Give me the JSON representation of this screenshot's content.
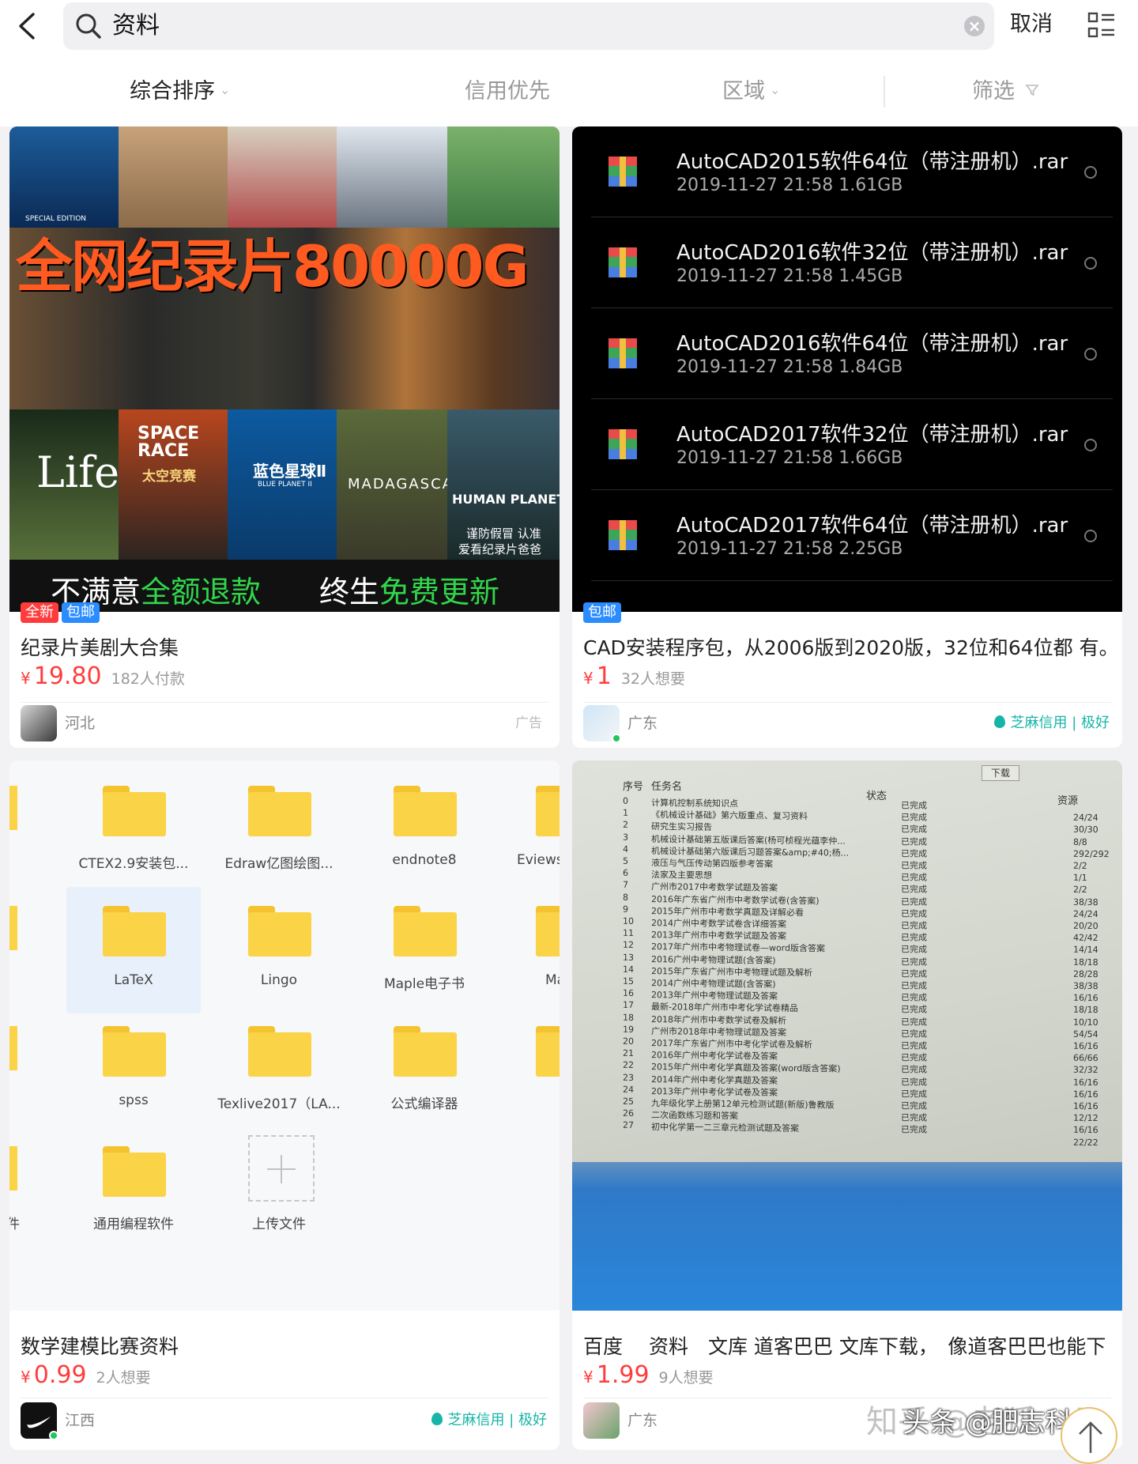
{
  "header": {
    "back_label": "",
    "search_query": "资料",
    "cancel_label": "取消"
  },
  "filters": {
    "sort": "综合排序",
    "credit": "信用优先",
    "region": "区域",
    "filter": "筛选"
  },
  "colors": {
    "price": "#ff3d3d",
    "credit": "#17b5a8",
    "tag_new": "#ff3b3b",
    "tag_ship": "#2b8cff",
    "folder": "#fbd346"
  },
  "cards": [
    {
      "image": {
        "headline": "全网纪录片80000G",
        "left_plain": "不满意",
        "left_highlight": "全额退款",
        "right_plain": "终生",
        "right_highlight": "免费更新",
        "posters": [
          "Life",
          "SPACE RACE",
          "太空竞赛",
          "蓝色星球Ⅱ",
          "BLUE PLANET II",
          "MADAGASCAR",
          "HUMAN PLANET",
          "谨防假冒 认准",
          "爱看纪录片爸爸"
        ],
        "special_edition": "SPECIAL EDITION"
      },
      "tags": [
        "全新",
        "包邮"
      ],
      "title": "纪录片美剧大合集",
      "currency": "¥",
      "price": "19.80",
      "want": "182人付款",
      "region": "河北",
      "ad": "广告"
    },
    {
      "files": [
        {
          "name": "AutoCAD2015软件64位（带注册机）.rar",
          "date": "2019-11-27  21:58",
          "size": "1.61GB"
        },
        {
          "name": "AutoCAD2016软件32位（带注册机）.rar",
          "date": "2019-11-27  21:58",
          "size": "1.45GB"
        },
        {
          "name": "AutoCAD2016软件64位（带注册机）.rar",
          "date": "2019-11-27  21:58",
          "size": "1.84GB"
        },
        {
          "name": "AutoCAD2017软件32位（带注册机）.rar",
          "date": "2019-11-27  21:58",
          "size": "1.66GB"
        },
        {
          "name": "AutoCAD2017软件64位（带注册机）.rar",
          "date": "2019-11-27  21:58",
          "size": "2.25GB"
        }
      ],
      "tags": [
        "包邮"
      ],
      "title": "CAD安装程序包，从2006版到2020版，32位和64位都 有。",
      "currency": "¥",
      "price": "1",
      "want": "32人想要",
      "region": "广东",
      "credit": "芝麻信用 | 极好"
    },
    {
      "folders": [
        {
          "label": "CTEX2.9安装包..."
        },
        {
          "label": "Edraw亿图绘图..."
        },
        {
          "label": "endnote8"
        },
        {
          "label": "Eviews"
        },
        {
          "label": "LaTeX"
        },
        {
          "label": "Lingo"
        },
        {
          "label": "Maple电子书"
        },
        {
          "label": "Mat"
        },
        {
          "label": "spss"
        },
        {
          "label": "Texlive2017（LA..."
        },
        {
          "label": "公式编译器"
        },
        {
          "label": "通用编程软件"
        },
        {
          "label": "上传文件"
        },
        {
          "label": "件"
        }
      ],
      "title": "数学建模比赛资料",
      "currency": "¥",
      "price": "0.99",
      "want": "2人想要",
      "region": "江西",
      "credit": "芝麻信用 | 极好"
    },
    {
      "list": {
        "download_tab": "下载",
        "col_no": "序号",
        "col_task": "任务名",
        "col_status": "状态",
        "col_res": "资源",
        "rows": [
          {
            "n": "0",
            "t": "计算机控制系统知识点",
            "s": "已完成",
            "r": ""
          },
          {
            "n": "1",
            "t": "《机械设计基础》第六版重点、复习资料",
            "s": "已完成",
            "r": "24/24"
          },
          {
            "n": "2",
            "t": "研究生实习报告",
            "s": "已完成",
            "r": "30/30"
          },
          {
            "n": "3",
            "t": "机械设计基础第五版课后答案(杨可桢程光蕴李仲...",
            "s": "已完成",
            "r": "8/8"
          },
          {
            "n": "4",
            "t": "机械设计基础第六版课后习题答案&amp;#40;杨...",
            "s": "已完成",
            "r": "292/292"
          },
          {
            "n": "5",
            "t": "液压与气压传动第四版参考答案",
            "s": "已完成",
            "r": "2/2"
          },
          {
            "n": "6",
            "t": "法家及主要思想",
            "s": "已完成",
            "r": "1/1"
          },
          {
            "n": "7",
            "t": "广州市2017中考数学试题及答案",
            "s": "已完成",
            "r": "2/2"
          },
          {
            "n": "8",
            "t": "2016年广东省广州市中考数学试卷(含答案)",
            "s": "已完成",
            "r": "38/38"
          },
          {
            "n": "9",
            "t": "2015年广州市中考数学真题及详解必看",
            "s": "已完成",
            "r": "24/24"
          },
          {
            "n": "10",
            "t": "2014广州中考数学试卷含详细答案",
            "s": "已完成",
            "r": "20/20"
          },
          {
            "n": "11",
            "t": "2013年广州市中考数学试题及答案",
            "s": "已完成",
            "r": "42/42"
          },
          {
            "n": "12",
            "t": "2017年广州市中考物理试卷—word版含答案",
            "s": "已完成",
            "r": "14/14"
          },
          {
            "n": "13",
            "t": "2016广州中考物理试题(含答案)",
            "s": "已完成",
            "r": "18/18"
          },
          {
            "n": "14",
            "t": "2015年广东省广州市中考物理试题及解析",
            "s": "已完成",
            "r": "28/28"
          },
          {
            "n": "15",
            "t": "2014广州中考物理试题(含答案)",
            "s": "已完成",
            "r": "38/38"
          },
          {
            "n": "16",
            "t": "2013年广州中考物理试题及答案",
            "s": "已完成",
            "r": "16/16"
          },
          {
            "n": "17",
            "t": "最新-2018年广州市中考化学试卷精品",
            "s": "已完成",
            "r": "18/18"
          },
          {
            "n": "18",
            "t": "2018年广州市中考数学试卷及解析",
            "s": "已完成",
            "r": "10/10"
          },
          {
            "n": "19",
            "t": "广州市2018年中考物理试题及答案",
            "s": "已完成",
            "r": "54/54"
          },
          {
            "n": "20",
            "t": "2017年广东省广州市中考化学试卷及解析",
            "s": "已完成",
            "r": "16/16"
          },
          {
            "n": "21",
            "t": "2016年广州中考化学试卷及答案",
            "s": "已完成",
            "r": "66/66"
          },
          {
            "n": "22",
            "t": "2015年广州中考化学真题及答案(word版含答案)",
            "s": "已完成",
            "r": "32/32"
          },
          {
            "n": "23",
            "t": "2014年广州中考化学真题及答案",
            "s": "已完成",
            "r": "16/16"
          },
          {
            "n": "24",
            "t": "2013年广州中考化学试卷及答案",
            "s": "已完成",
            "r": "16/16"
          },
          {
            "n": "25",
            "t": "九年级化学上册第12单元检测试题(新版)鲁教版",
            "s": "已完成",
            "r": "16/16"
          },
          {
            "n": "26",
            "t": "二次函数练习题和答案",
            "s": "已完成",
            "r": "12/12"
          },
          {
            "n": "27",
            "t": "初中化学第一二三章元检测试题及答案",
            "s": "已完成",
            "r": "16/16"
          },
          {
            "n": "",
            "t": "",
            "s": "",
            "r": "22/22"
          }
        ]
      },
      "title": "百度　 资料　文库 道客巴巴 文库下载，　像道客巴巴也能下",
      "currency": "¥",
      "price": "1.99",
      "want": "9人想要",
      "region": "广东"
    }
  ],
  "watermark": {
    "left": "知乎 @老狐",
    "right": "头条 @肥志科普"
  }
}
